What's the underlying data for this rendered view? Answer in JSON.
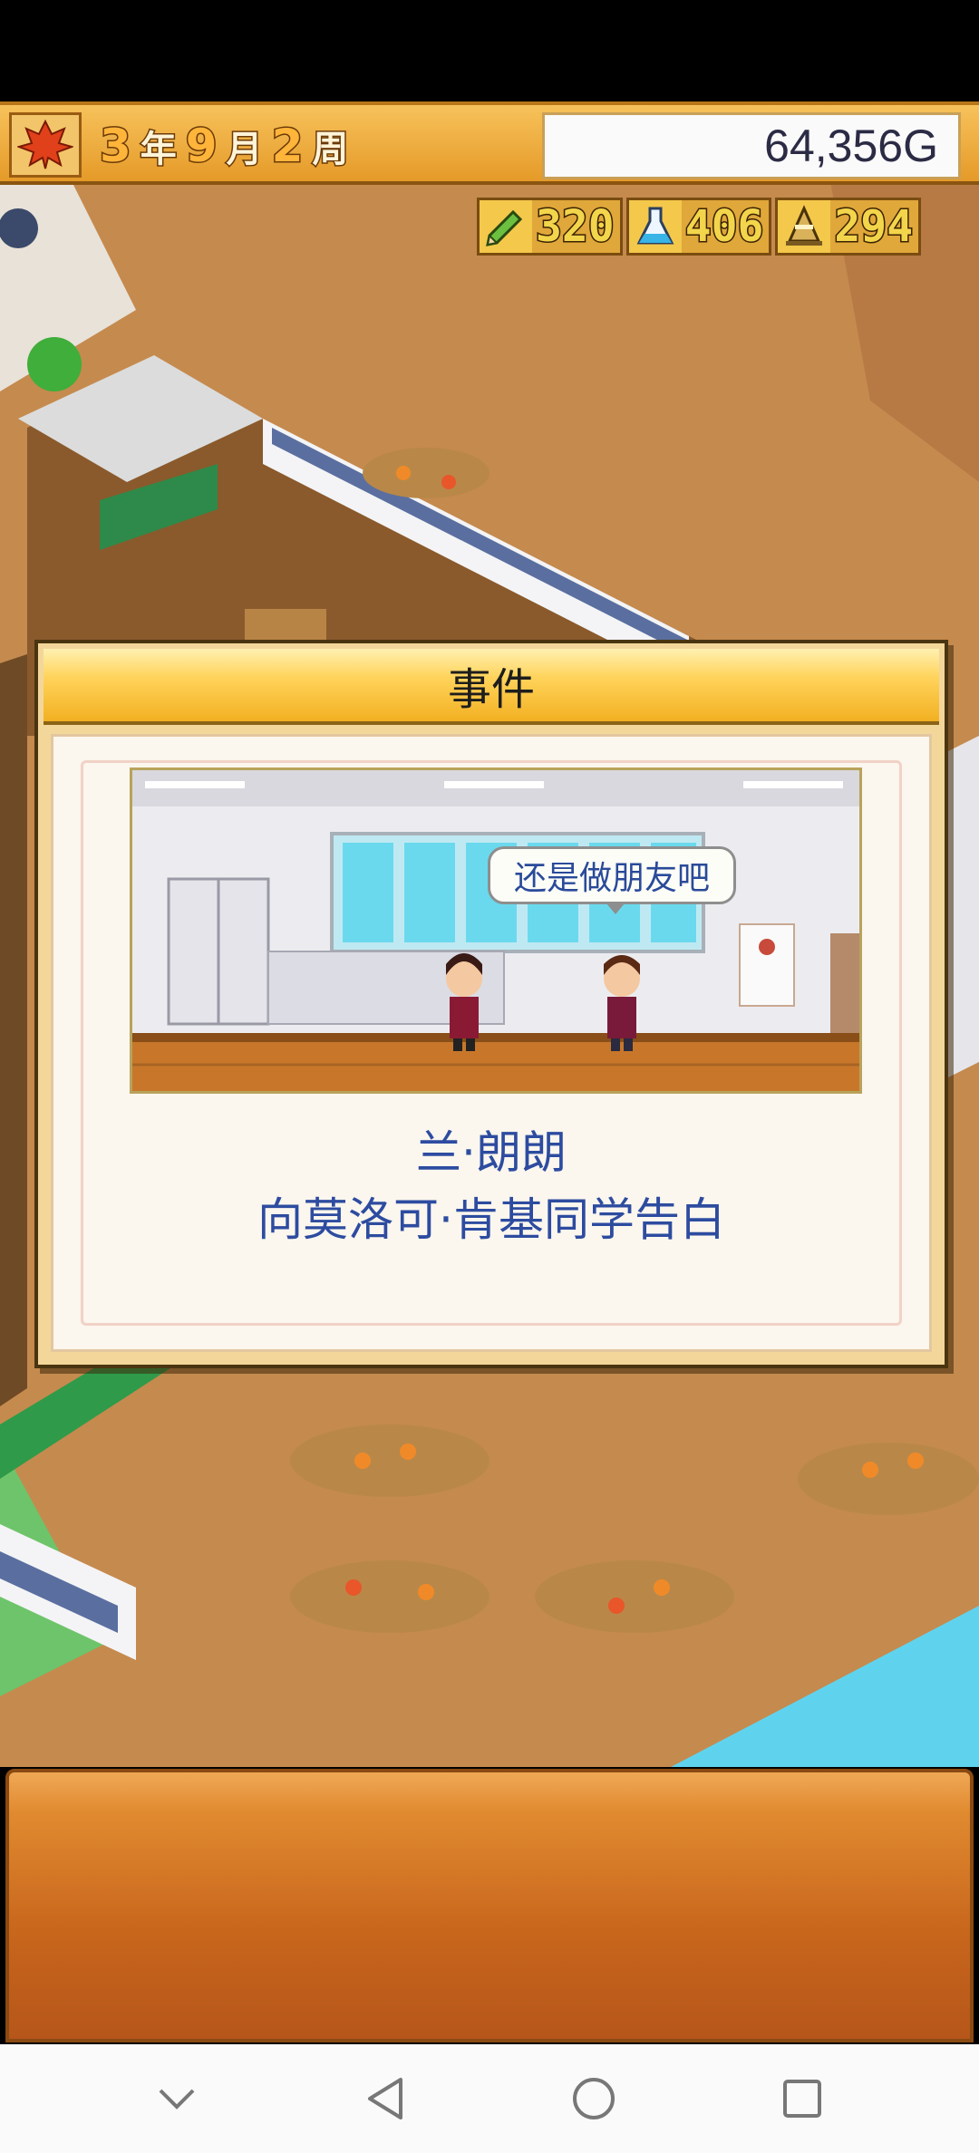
{
  "hud": {
    "year": "3",
    "year_unit": "年",
    "month": "9",
    "month_unit": "月",
    "week": "2",
    "week_unit": "周",
    "money": "64,356G",
    "season_icon": "maple-leaf-icon"
  },
  "resources": [
    {
      "icon": "pencil-icon",
      "value": "320"
    },
    {
      "icon": "flask-icon",
      "value": "406"
    },
    {
      "icon": "cone-icon",
      "value": "294"
    }
  ],
  "event": {
    "title": "事件",
    "speech": "还是做朋友吧",
    "line1": "兰·朗朗",
    "line2": "向莫洛可·肯基同学告白"
  },
  "nav": {
    "buttons": [
      "collapse-icon",
      "back-icon",
      "home-icon",
      "recents-icon"
    ]
  },
  "colors": {
    "hud": "#f0b040",
    "dialog_header": "#ffd35a",
    "event_text": "#2d4ca0",
    "ground": "#c58a4e"
  }
}
